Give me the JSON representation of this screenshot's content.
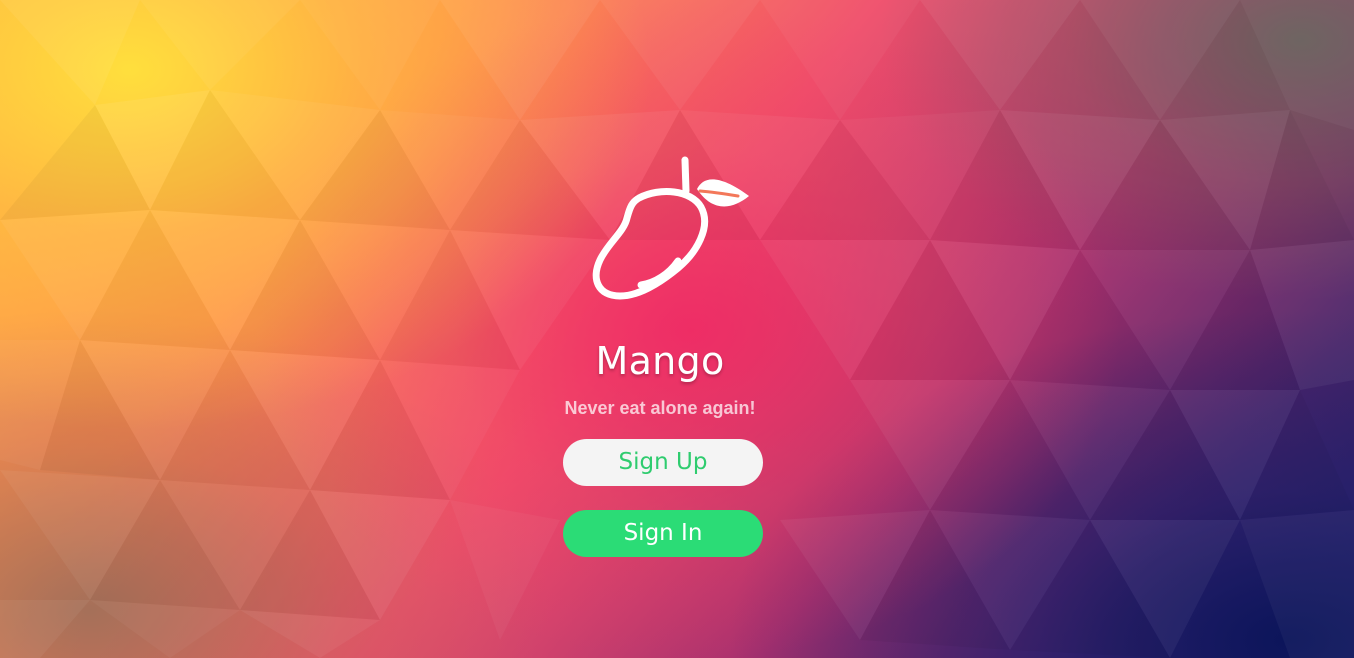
{
  "app": {
    "title": "Mango",
    "tagline": "Never eat alone again!"
  },
  "actions": {
    "signup_label": "Sign Up",
    "signin_label": "Sign In"
  },
  "icons": {
    "logo": "mango-icon"
  },
  "colors": {
    "signup_bg": "#f4f4f4",
    "signup_text": "#2fcc6f",
    "signin_bg": "#2bdc76",
    "signin_text": "#ffffff"
  }
}
